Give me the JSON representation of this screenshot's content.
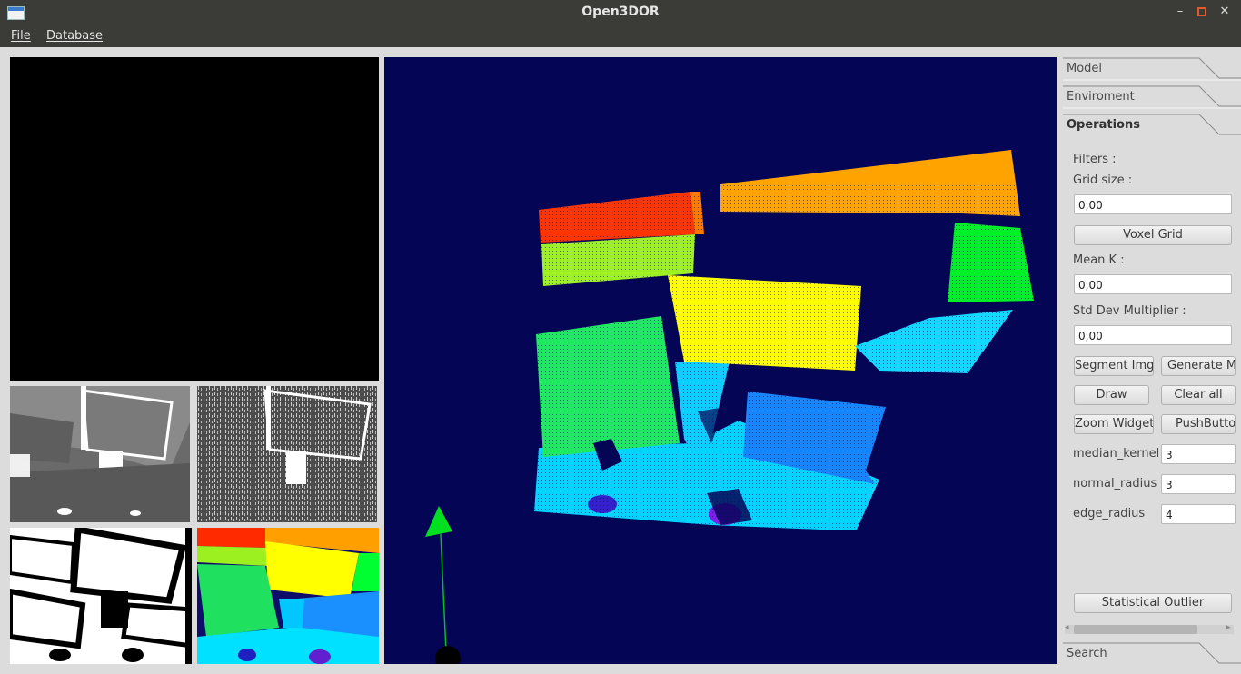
{
  "window": {
    "title": "Open3DOR"
  },
  "menu": {
    "file": "File",
    "database": "Database"
  },
  "window_controls": {
    "minimize_icon": "minimize-icon",
    "maximize_icon": "maximize-icon",
    "close_icon": "close-icon",
    "close_color": "#e05a2b"
  },
  "sidebar": {
    "tabs": {
      "model": "Model",
      "environment": "Enviroment",
      "operations": "Operations",
      "search": "Search"
    },
    "operations": {
      "filters_label": "Filters :",
      "grid_size_label": "Grid size :",
      "grid_size_value": "0,00",
      "voxel_grid_button": "Voxel Grid",
      "mean_k_label": "Mean K :",
      "mean_k_value": "0,00",
      "std_dev_label": "Std Dev Multiplier :",
      "std_dev_value": "0,00",
      "segment_img_button": "Segment Img",
      "generate_mesh_button": "Generate Me",
      "draw_button": "Draw",
      "clear_all_button": "Clear all",
      "zoom_widget_button": "Zoom Widget",
      "push_button": "PushButtor",
      "median_kernel_label": "median_kernel",
      "median_kernel_value": "3",
      "normal_radius_label": "normal_radius",
      "normal_radius_value": "3",
      "edge_radius_label": "edge_radius",
      "edge_radius_value": "4",
      "statistical_outlier_button": "Statistical Outlier"
    }
  },
  "colors": {
    "chrome": "#3b3b37",
    "panel": "#dcdcdc",
    "viewer_bg": "#050556"
  }
}
